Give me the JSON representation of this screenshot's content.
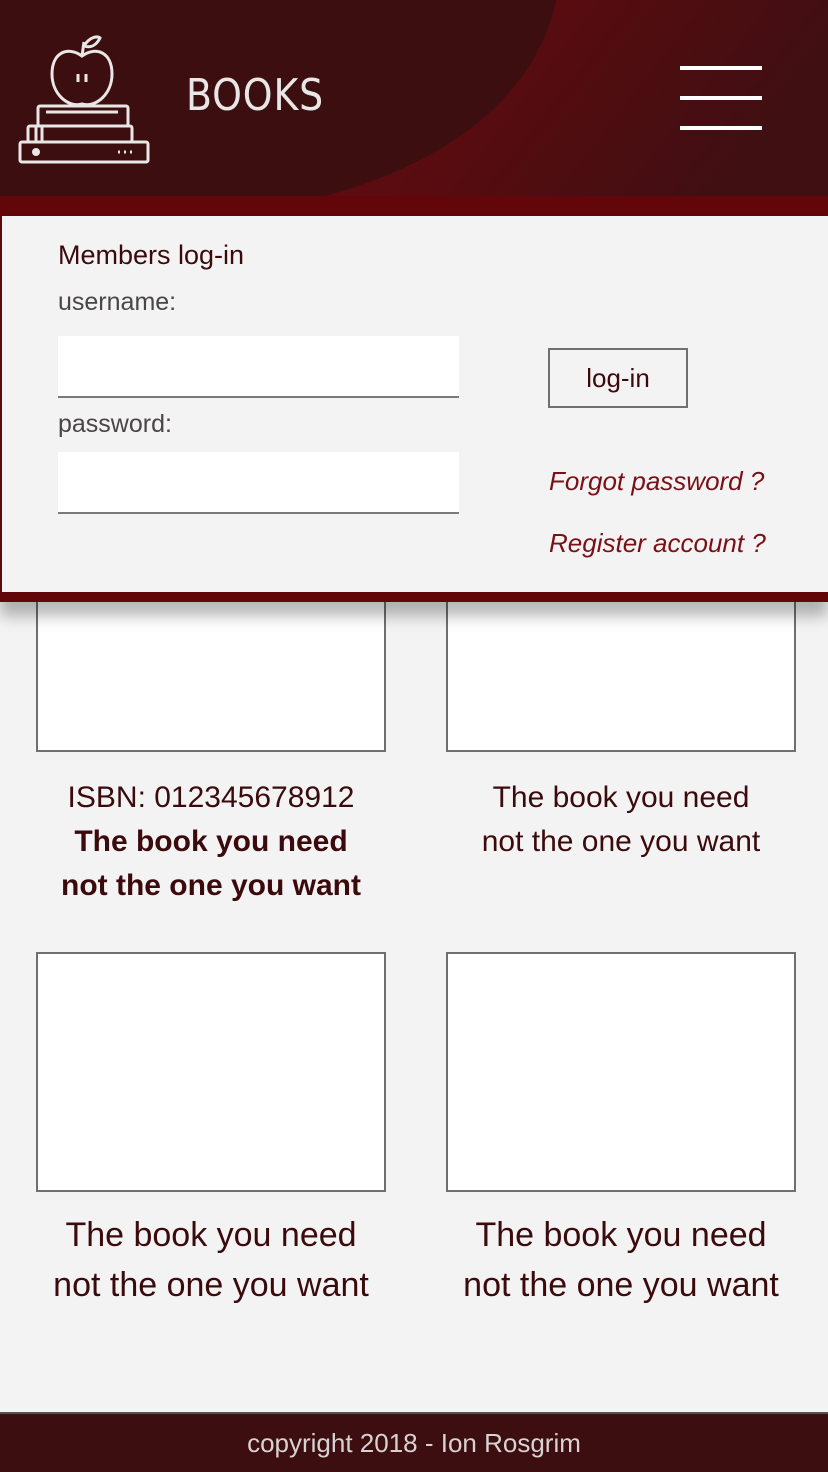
{
  "header": {
    "brand": "BOOKS",
    "logo_icon": "apple-on-books-icon",
    "menu_icon": "hamburger-menu-icon",
    "colors": {
      "dark": "#3d0e10",
      "accent": "#620609"
    }
  },
  "login": {
    "title": "Members log-in",
    "username_label": "username:",
    "username_value": "",
    "password_label": "password:",
    "password_value": "",
    "submit_label": "log-in",
    "forgot_link": "Forgot password ?",
    "register_link": "Register account ?"
  },
  "books": [
    {
      "isbn": "ISBN: 012345678912",
      "line1": "The book you need",
      "line2": "not the one you want"
    },
    {
      "line1": "The book you need",
      "line2": "not the one you want"
    },
    {
      "line1": "The book you need",
      "line2": "not the one you want"
    },
    {
      "line1": "The book you need",
      "line2": "not the one you want"
    }
  ],
  "footer": {
    "copyright": "copyright 2018 - Ion Rosgrim"
  }
}
